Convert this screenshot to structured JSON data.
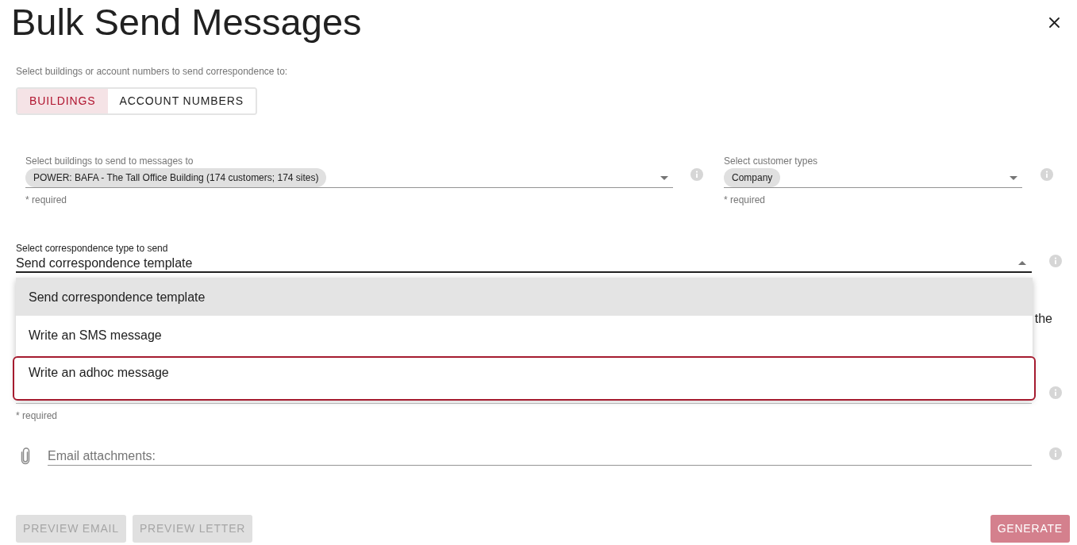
{
  "window": {
    "title": "Bulk Send Messages"
  },
  "recipient_mode": {
    "label": "Select buildings or account numbers to send correspondence to:",
    "options": [
      {
        "label": "BUILDINGS",
        "selected": true
      },
      {
        "label": "ACCOUNT NUMBERS",
        "selected": false
      }
    ]
  },
  "buildings_select": {
    "label": "Select buildings to send to messages to",
    "chips": [
      "POWER: BAFA - The Tall Office Building (174 customers; 174 sites)"
    ],
    "helper": "* required",
    "expanded": false
  },
  "customer_types_select": {
    "label": "Select customer types",
    "chips": [
      "Company"
    ],
    "helper": "* required",
    "expanded": false
  },
  "correspondence_type_select": {
    "label": "Select correspondence type to send",
    "value": "Send correspondence template",
    "expanded": true,
    "options": [
      {
        "label": "Send correspondence template",
        "selected": true,
        "outlined": false
      },
      {
        "label": "Write an SMS message",
        "selected": false,
        "outlined": false
      },
      {
        "label": "Write an adhoc message",
        "selected": false,
        "outlined": true
      }
    ]
  },
  "covered_paragraph": {
    "text": "the"
  },
  "covered_field": {
    "helper": "* required"
  },
  "attachments": {
    "placeholder": "Email attachments:"
  },
  "buttons": [
    {
      "label": "PREVIEW EMAIL",
      "kind": "secondary",
      "disabled": true
    },
    {
      "label": "PREVIEW LETTER",
      "kind": "secondary",
      "disabled": true
    },
    {
      "label": "GENERATE",
      "kind": "primary",
      "disabled": true
    }
  ]
}
